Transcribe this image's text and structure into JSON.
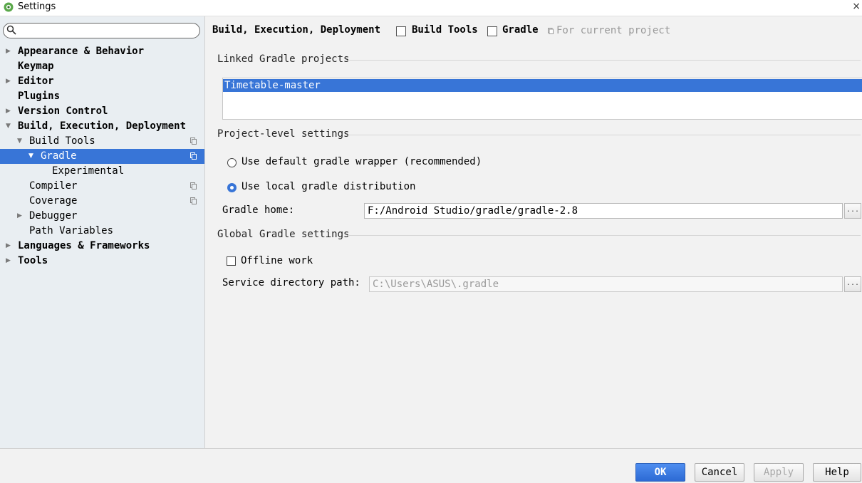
{
  "window": {
    "title": "Settings",
    "close_glyph": "×"
  },
  "search": {
    "placeholder": "",
    "value": ""
  },
  "tree": [
    {
      "label": "Appearance & Behavior",
      "level": 0,
      "bold": true,
      "expanded": false,
      "has_children": true
    },
    {
      "label": "Keymap",
      "level": 0,
      "bold": true,
      "has_children": false
    },
    {
      "label": "Editor",
      "level": 0,
      "bold": true,
      "expanded": false,
      "has_children": true
    },
    {
      "label": "Plugins",
      "level": 0,
      "bold": true,
      "has_children": false
    },
    {
      "label": "Version Control",
      "level": 0,
      "bold": true,
      "expanded": false,
      "has_children": true
    },
    {
      "label": "Build, Execution, Deployment",
      "level": 0,
      "bold": true,
      "expanded": true,
      "has_children": true
    },
    {
      "label": "Build Tools",
      "level": 1,
      "expanded": true,
      "has_children": true,
      "project_icon": true
    },
    {
      "label": "Gradle",
      "level": 2,
      "expanded": true,
      "has_children": true,
      "selected": true,
      "project_icon": true
    },
    {
      "label": "Experimental",
      "level": 3,
      "has_children": false
    },
    {
      "label": "Compiler",
      "level": 1,
      "has_children": false,
      "project_icon": true
    },
    {
      "label": "Coverage",
      "level": 1,
      "has_children": false,
      "project_icon": true
    },
    {
      "label": "Debugger",
      "level": 1,
      "expanded": false,
      "has_children": true
    },
    {
      "label": "Path Variables",
      "level": 1,
      "has_children": false
    },
    {
      "label": "Languages & Frameworks",
      "level": 0,
      "bold": true,
      "expanded": false,
      "has_children": true
    },
    {
      "label": "Tools",
      "level": 0,
      "bold": true,
      "expanded": false,
      "has_children": true
    }
  ],
  "breadcrumb": {
    "items": [
      "Build, Execution, Deployment",
      "Build Tools",
      "Gradle"
    ],
    "note": "For current project"
  },
  "linked_projects": {
    "title": "Linked Gradle projects",
    "items": [
      "Timetable-master"
    ]
  },
  "project_settings": {
    "title": "Project-level settings",
    "options": [
      {
        "label": "Use default gradle wrapper (recommended)",
        "selected": false
      },
      {
        "label": "Use local gradle distribution",
        "selected": true
      }
    ],
    "gradle_home_label": "Gradle home:",
    "gradle_home_value": "F:/Android Studio/gradle/gradle-2.8",
    "browse_label": "..."
  },
  "global_settings": {
    "title": "Global Gradle settings",
    "offline_label": "Offline work",
    "offline_checked": false,
    "service_dir_label": "Service directory path:",
    "service_dir_value": "C:\\Users\\ASUS\\.gradle",
    "browse_label": "..."
  },
  "buttons": {
    "ok": "OK",
    "cancel": "Cancel",
    "apply": "Apply",
    "help": "Help"
  },
  "colors": {
    "selection": "#3875d7",
    "sidebar_bg": "#e9eef2",
    "panel_bg": "#f2f2f2"
  }
}
